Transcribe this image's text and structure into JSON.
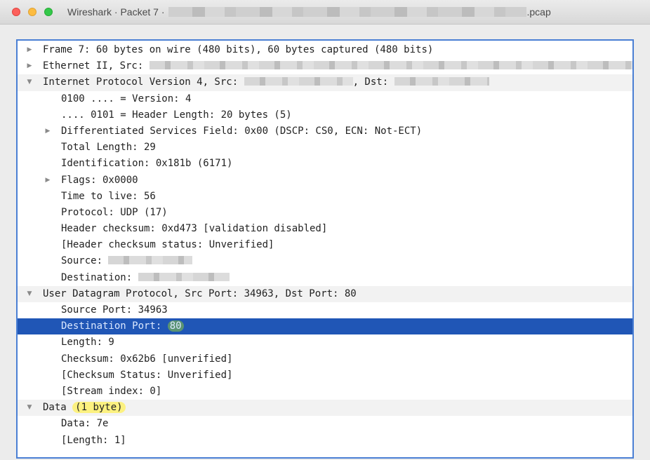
{
  "window": {
    "title_prefix": "Wireshark · Packet 7 ·",
    "title_suffix": ".pcap"
  },
  "tree": [
    {
      "level": 0,
      "expander": "collapsed",
      "text": "Frame 7: 60 bytes on wire (480 bits), 60 bytes captured (480 bits)"
    },
    {
      "level": 0,
      "expander": "collapsed",
      "text": "Ethernet II, Src: ",
      "masked": true
    },
    {
      "level": 0,
      "expander": "expanded",
      "text": "Internet Protocol Version 4, Src: ",
      "masked": true,
      "text2": ", Dst: ",
      "masked2": true
    },
    {
      "level": 1,
      "expander": "none",
      "text": "0100 .... = Version: 4"
    },
    {
      "level": 1,
      "expander": "none",
      "text": ".... 0101 = Header Length: 20 bytes (5)"
    },
    {
      "level": 1,
      "expander": "collapsed",
      "text": "Differentiated Services Field: 0x00 (DSCP: CS0, ECN: Not-ECT)"
    },
    {
      "level": 1,
      "expander": "none",
      "text": "Total Length: 29"
    },
    {
      "level": 1,
      "expander": "none",
      "text": "Identification: 0x181b (6171)"
    },
    {
      "level": 1,
      "expander": "collapsed",
      "text": "Flags: 0x0000"
    },
    {
      "level": 1,
      "expander": "none",
      "text": "Time to live: 56"
    },
    {
      "level": 1,
      "expander": "none",
      "text": "Protocol: UDP (17)"
    },
    {
      "level": 1,
      "expander": "none",
      "text": "Header checksum: 0xd473 [validation disabled]"
    },
    {
      "level": 1,
      "expander": "none",
      "text": "[Header checksum status: Unverified]"
    },
    {
      "level": 1,
      "expander": "none",
      "text": "Source: ",
      "masked": true
    },
    {
      "level": 1,
      "expander": "none",
      "text": "Destination: ",
      "masked": true
    },
    {
      "level": 0,
      "expander": "expanded",
      "text": "User Datagram Protocol, Src Port: 34963, Dst Port: 80"
    },
    {
      "level": 1,
      "expander": "none",
      "text": "Source Port: 34963"
    },
    {
      "level": 1,
      "expander": "none",
      "text": "Destination Port: ",
      "highlight_value": "80",
      "selected": true
    },
    {
      "level": 1,
      "expander": "none",
      "text": "Length: 9"
    },
    {
      "level": 1,
      "expander": "none",
      "text": "Checksum: 0x62b6 [unverified]"
    },
    {
      "level": 1,
      "expander": "none",
      "text": "[Checksum Status: Unverified]"
    },
    {
      "level": 1,
      "expander": "none",
      "text": "[Stream index: 0]"
    },
    {
      "level": 0,
      "expander": "expanded",
      "text": "Data ",
      "marked_value": "(1 byte)"
    },
    {
      "level": 1,
      "expander": "none",
      "text": "Data: 7e"
    },
    {
      "level": 1,
      "expander": "none",
      "text": "[Length: 1]"
    }
  ],
  "colors": {
    "selection": "#2056b6",
    "panel_border": "#4a7fd4",
    "green_marker": "#8cc83c",
    "yellow_marker": "#fff05a"
  }
}
